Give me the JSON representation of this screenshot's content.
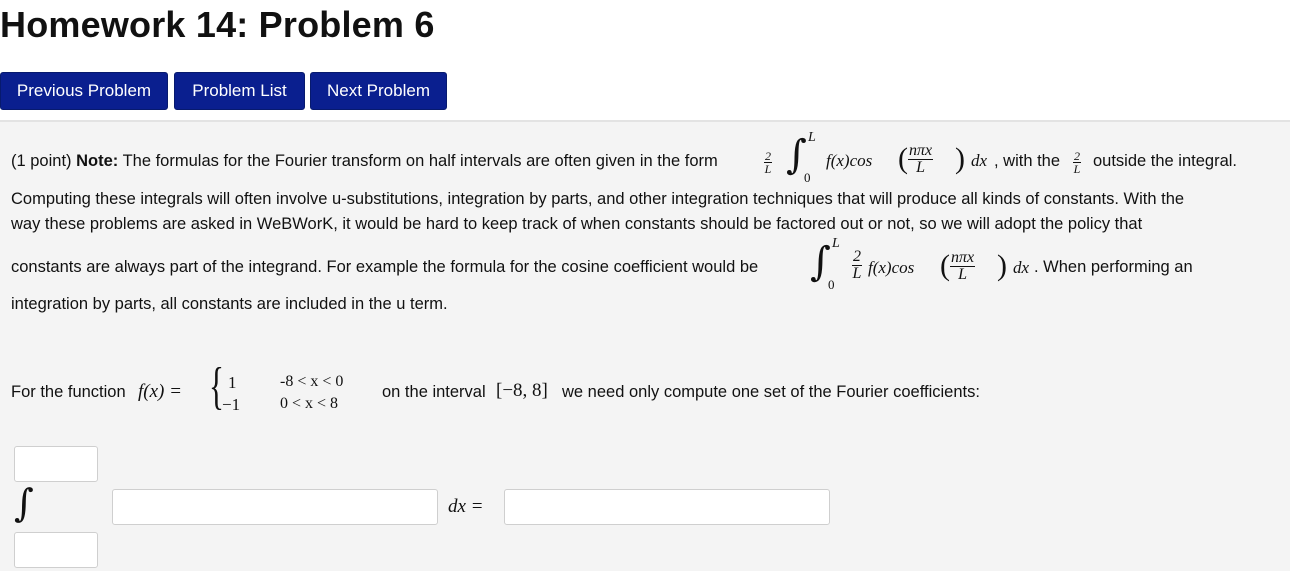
{
  "header": {
    "title": "Homework 14: Problem 6"
  },
  "nav": {
    "previous": "Previous Problem",
    "list": "Problem List",
    "next": "Next Problem"
  },
  "problem": {
    "line1_points": "(1 point) ",
    "line1_note": "Note:",
    "line1_text": " The formulas for the Fourier transform on half intervals are often given in the form",
    "line1_after": ", with the",
    "line1_end": "outside the integral.",
    "line2": "Computing these integrals will often involve u-substitutions, integration by parts, and other integration techniques that will produce all kinds of constants. With the",
    "line3": "way these problems are asked in WeBWorK, it would be hard to keep track of when constants should be factored out or not, so we will adopt the policy that",
    "line4_text": "constants are always part of the integrand. For example the formula for the cosine coefficient would be",
    "line4_after": ". When performing an",
    "line5": "integration by parts, all constants are included in the u term.",
    "func_prefix": "For the function",
    "func_name": "f(x) =",
    "piece1_value": "1",
    "piece1_cond": "-8 < x < 0",
    "piece2_value": "−1",
    "piece2_cond": "0 < x < 8",
    "interval_prefix": "on the interval",
    "interval": "[−8, 8]",
    "interval_suffix": "we need only compute one set of the Fourier coefficients:",
    "dx_equals": "dx ="
  },
  "math": {
    "two": "2",
    "L": "L",
    "zero": "0",
    "fx_cos": "f(x)cos",
    "n_pi_x": "nπx",
    "dx": "dx",
    "integral": "∫"
  }
}
